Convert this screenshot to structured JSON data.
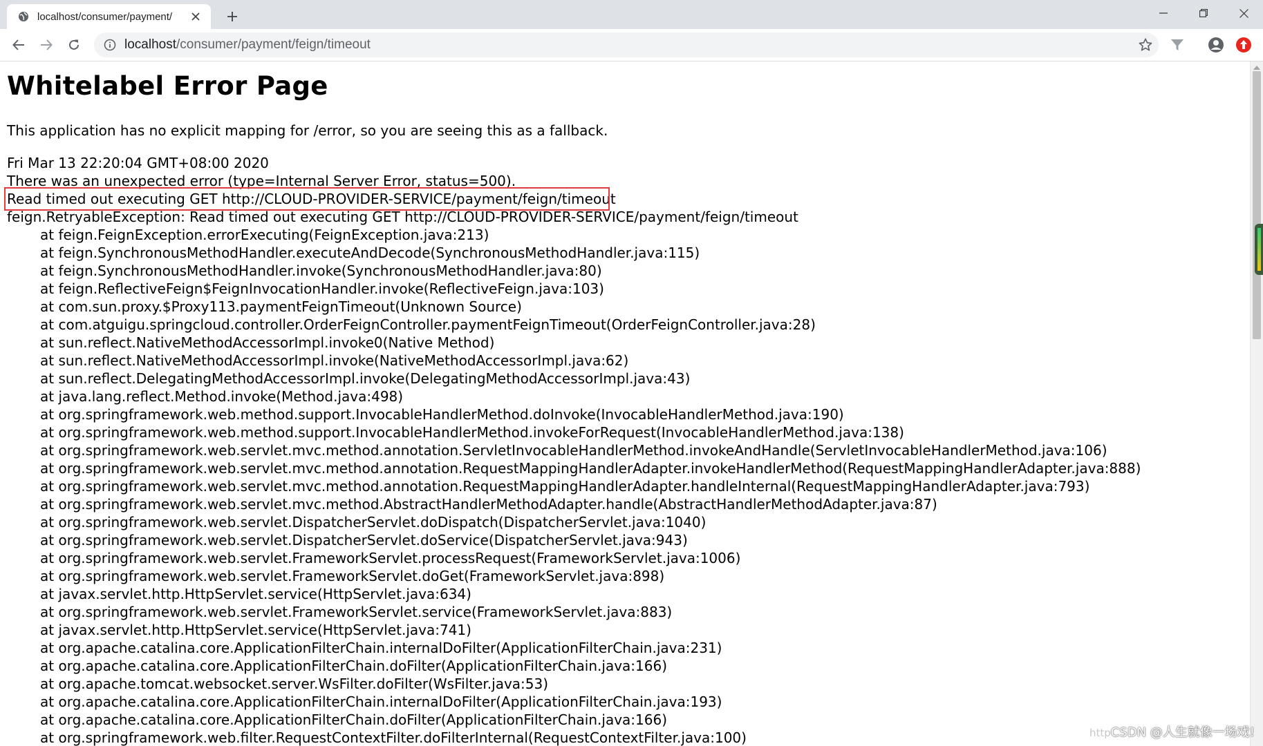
{
  "tab": {
    "title": "localhost/consumer/payment/"
  },
  "toolbar": {
    "url_host": "localhost",
    "url_path": "/consumer/payment/feign/timeout"
  },
  "page": {
    "title": "Whitelabel Error Page",
    "fallback": "This application has no explicit mapping for /error, so you are seeing this as a fallback.",
    "timestamp": "Fri Mar 13 22:20:04 GMT+08:00 2020",
    "error_summary": "There was an unexpected error (type=Internal Server Error, status=500).",
    "message": "Read timed out executing GET http://CLOUD-PROVIDER-SERVICE/payment/feign/timeout",
    "exception": "feign.RetryableException: Read timed out executing GET http://CLOUD-PROVIDER-SERVICE/payment/feign/timeout",
    "stack": [
      "at feign.FeignException.errorExecuting(FeignException.java:213)",
      "at feign.SynchronousMethodHandler.executeAndDecode(SynchronousMethodHandler.java:115)",
      "at feign.SynchronousMethodHandler.invoke(SynchronousMethodHandler.java:80)",
      "at feign.ReflectiveFeign$FeignInvocationHandler.invoke(ReflectiveFeign.java:103)",
      "at com.sun.proxy.$Proxy113.paymentFeignTimeout(Unknown Source)",
      "at com.atguigu.springcloud.controller.OrderFeignController.paymentFeignTimeout(OrderFeignController.java:28)",
      "at sun.reflect.NativeMethodAccessorImpl.invoke0(Native Method)",
      "at sun.reflect.NativeMethodAccessorImpl.invoke(NativeMethodAccessorImpl.java:62)",
      "at sun.reflect.DelegatingMethodAccessorImpl.invoke(DelegatingMethodAccessorImpl.java:43)",
      "at java.lang.reflect.Method.invoke(Method.java:498)",
      "at org.springframework.web.method.support.InvocableHandlerMethod.doInvoke(InvocableHandlerMethod.java:190)",
      "at org.springframework.web.method.support.InvocableHandlerMethod.invokeForRequest(InvocableHandlerMethod.java:138)",
      "at org.springframework.web.servlet.mvc.method.annotation.ServletInvocableHandlerMethod.invokeAndHandle(ServletInvocableHandlerMethod.java:106)",
      "at org.springframework.web.servlet.mvc.method.annotation.RequestMappingHandlerAdapter.invokeHandlerMethod(RequestMappingHandlerAdapter.java:888)",
      "at org.springframework.web.servlet.mvc.method.annotation.RequestMappingHandlerAdapter.handleInternal(RequestMappingHandlerAdapter.java:793)",
      "at org.springframework.web.servlet.mvc.method.AbstractHandlerMethodAdapter.handle(AbstractHandlerMethodAdapter.java:87)",
      "at org.springframework.web.servlet.DispatcherServlet.doDispatch(DispatcherServlet.java:1040)",
      "at org.springframework.web.servlet.DispatcherServlet.doService(DispatcherServlet.java:943)",
      "at org.springframework.web.servlet.FrameworkServlet.processRequest(FrameworkServlet.java:1006)",
      "at org.springframework.web.servlet.FrameworkServlet.doGet(FrameworkServlet.java:898)",
      "at javax.servlet.http.HttpServlet.service(HttpServlet.java:634)",
      "at org.springframework.web.servlet.FrameworkServlet.service(FrameworkServlet.java:883)",
      "at javax.servlet.http.HttpServlet.service(HttpServlet.java:741)",
      "at org.apache.catalina.core.ApplicationFilterChain.internalDoFilter(ApplicationFilterChain.java:231)",
      "at org.apache.catalina.core.ApplicationFilterChain.doFilter(ApplicationFilterChain.java:166)",
      "at org.apache.tomcat.websocket.server.WsFilter.doFilter(WsFilter.java:53)",
      "at org.apache.catalina.core.ApplicationFilterChain.internalDoFilter(ApplicationFilterChain.java:193)",
      "at org.apache.catalina.core.ApplicationFilterChain.doFilter(ApplicationFilterChain.java:166)",
      "at org.springframework.web.filter.RequestContextFilter.doFilterInternal(RequestContextFilter.java:100)"
    ]
  },
  "watermark": {
    "prefix": "http",
    "text": "CSDN @人生就像一场戏!"
  },
  "colors": {
    "tabstrip": "#dee1e6",
    "omnibox": "#f1f3f4",
    "highlight": "#e23b3b"
  }
}
